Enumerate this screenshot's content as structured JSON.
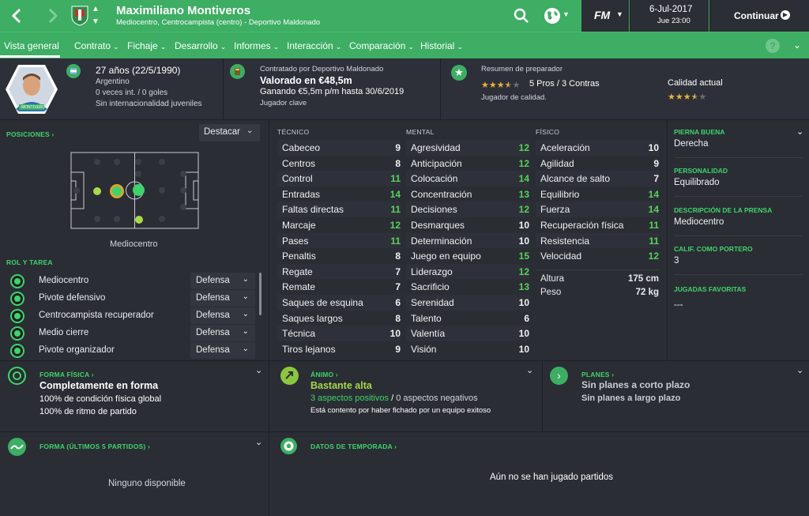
{
  "header": {
    "player_name": "Maximiliano Montiveros",
    "subtitle": "Mediocentro, Centrocampista (centro) - Deportivo Maldonado",
    "game_logo": "FM",
    "date": "6-Jul-2017",
    "time": "Jue 23:00",
    "continue_label": "Continuar"
  },
  "nav": {
    "items": [
      {
        "label": "Vista general"
      },
      {
        "label": "Contrato"
      },
      {
        "label": "Fichaje"
      },
      {
        "label": "Desarrollo"
      },
      {
        "label": "Informes"
      },
      {
        "label": "Interacción"
      },
      {
        "label": "Comparación"
      },
      {
        "label": "Historial"
      }
    ],
    "help": "?"
  },
  "summary": {
    "photo_label": "MONTIVEROS",
    "age": "27 años (22/5/1990)",
    "nationality": "Argentino",
    "caps": "0 veces int. / 0 goles",
    "youth": "Sin internacionalidad juveniles",
    "contract_by": "Contratado por Deportivo Maldonado",
    "value": "Valorado en €48,5m",
    "wage": "Ganando €5,5m p/m hasta 30/6/2019",
    "status": "Jugador clave",
    "coach_title": "Resumen de preparador",
    "pros_cons": "5 Pros / 3 Contras",
    "coach_desc": "Jugador de calidad.",
    "coach_stars": 3.5,
    "current_quality": "Calidad actual",
    "current_stars": 3.5
  },
  "positions": {
    "title": "POSICIONES",
    "highlight": "Destacar",
    "label": "Mediocentro"
  },
  "role": {
    "title": "ROL Y TAREA",
    "rows": [
      {
        "name": "Mediocentro",
        "duty": "Defensa"
      },
      {
        "name": "Pivote defensivo",
        "duty": "Defensa"
      },
      {
        "name": "Centrocampista recuperador",
        "duty": "Defensa"
      },
      {
        "name": "Medio cierre",
        "duty": "Defensa"
      },
      {
        "name": "Pivote organizador",
        "duty": "Defensa"
      }
    ]
  },
  "attributes": {
    "technical_title": "TÉCNICO",
    "mental_title": "MENTAL",
    "physical_title": "FÍSICO",
    "technical": [
      {
        "name": "Cabeceo",
        "value": 9
      },
      {
        "name": "Centros",
        "value": 8
      },
      {
        "name": "Control",
        "value": 11
      },
      {
        "name": "Entradas",
        "value": 14
      },
      {
        "name": "Faltas directas",
        "value": 11
      },
      {
        "name": "Marcaje",
        "value": 12
      },
      {
        "name": "Pases",
        "value": 11
      },
      {
        "name": "Penaltis",
        "value": 8
      },
      {
        "name": "Regate",
        "value": 7
      },
      {
        "name": "Remate",
        "value": 7
      },
      {
        "name": "Saques de esquina",
        "value": 6
      },
      {
        "name": "Saques largos",
        "value": 8
      },
      {
        "name": "Técnica",
        "value": 10
      },
      {
        "name": "Tiros lejanos",
        "value": 9
      }
    ],
    "mental": [
      {
        "name": "Agresividad",
        "value": 12
      },
      {
        "name": "Anticipación",
        "value": 12
      },
      {
        "name": "Colocación",
        "value": 14
      },
      {
        "name": "Concentración",
        "value": 13
      },
      {
        "name": "Decisiones",
        "value": 12
      },
      {
        "name": "Desmarques",
        "value": 10
      },
      {
        "name": "Determinación",
        "value": 10
      },
      {
        "name": "Juego en equipo",
        "value": 15
      },
      {
        "name": "Liderazgo",
        "value": 12
      },
      {
        "name": "Sacrificio",
        "value": 13
      },
      {
        "name": "Serenidad",
        "value": 10
      },
      {
        "name": "Talento",
        "value": 6
      },
      {
        "name": "Valentía",
        "value": 10
      },
      {
        "name": "Visión",
        "value": 10
      }
    ],
    "physical": [
      {
        "name": "Aceleración",
        "value": 10
      },
      {
        "name": "Agilidad",
        "value": 9
      },
      {
        "name": "Alcance de salto",
        "value": 7
      },
      {
        "name": "Equilibrio",
        "value": 14
      },
      {
        "name": "Fuerza",
        "value": 14
      },
      {
        "name": "Recuperación física",
        "value": 11
      },
      {
        "name": "Resistencia",
        "value": 11
      },
      {
        "name": "Velocidad",
        "value": 12
      }
    ],
    "height_label": "Altura",
    "height_value": "175 cm",
    "weight_label": "Peso",
    "weight_value": "72 kg"
  },
  "right_panel": {
    "foot_label": "PIERNA BUENA",
    "foot_value": "Derecha",
    "personality_label": "PERSONALIDAD",
    "personality_value": "Equilibrado",
    "press_label": "DESCRIPCIÓN DE LA PRENSA",
    "press_value": "Mediocentro",
    "gk_label": "CALIF. COMO PORTERO",
    "gk_value": "3",
    "plays_label": "JUGADAS FAVORITAS",
    "plays_value": "---"
  },
  "fitness": {
    "title": "FORMA FÍSICA",
    "headline": "Completamente en forma",
    "line1": "100% de condición física global",
    "line2": "100% de ritmo de partido"
  },
  "morale": {
    "title": "ÁNIMO",
    "headline": "Bastante alta",
    "positives": "3 aspectos positivos",
    "slash": "/",
    "negatives": "0 aspectos negativos",
    "note": "Está contento por haber fichado por un equipo exitoso"
  },
  "plans": {
    "title": "PLANES",
    "short": "Sin planes a corto plazo",
    "long": "Sin planes a largo plazo"
  },
  "form": {
    "title": "FORMA (ÚLTIMOS 5 PARTIDOS)",
    "empty": "Ninguno disponible"
  },
  "season": {
    "title": "DATOS DE TEMPORADA",
    "empty": "Aún no se han jugado partidos"
  },
  "colors": {
    "accent": "#3dae63",
    "attr_green": "#58d25a",
    "bg": "#2a2d34",
    "star": "#e8b33a"
  }
}
